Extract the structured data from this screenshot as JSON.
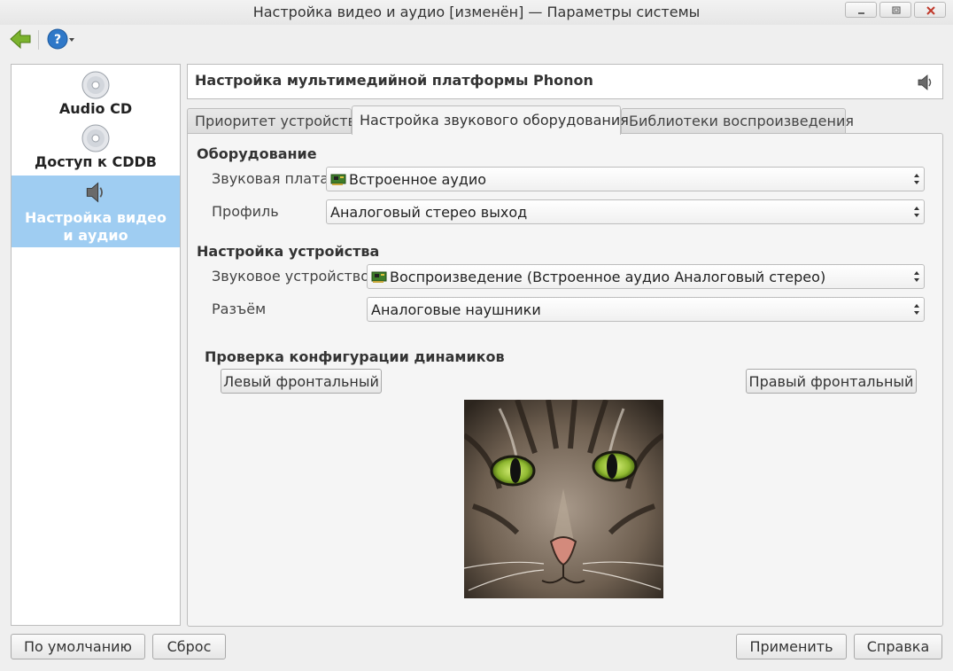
{
  "window": {
    "title": "Настройка видео и аудио [изменён] — Параметры системы"
  },
  "sidebar": {
    "items": [
      {
        "label": "Audio CD",
        "icon": "cd-icon"
      },
      {
        "label": "Доступ к CDDB",
        "icon": "cd-icon"
      },
      {
        "label": "Настройка видео и аудио",
        "icon": "speaker-icon",
        "selected": true
      }
    ]
  },
  "header": {
    "title": "Настройка мультимедийной платформы Phonon"
  },
  "tabs": [
    {
      "label": "Приоритет устройства"
    },
    {
      "label": "Настройка звукового оборудования",
      "active": true
    },
    {
      "label": "Библиотеки воспроизведения"
    }
  ],
  "hardware": {
    "group_title": "Оборудование",
    "sound_card_label": "Звуковая плата",
    "sound_card_value": "Встроенное аудио",
    "profile_label": "Профиль",
    "profile_value": "Аналоговый стерео выход"
  },
  "device": {
    "group_title": "Настройка устройства",
    "sound_device_label": "Звуковое устройство",
    "sound_device_value": "Воспроизведение (Встроенное аудио Аналоговый стерео)",
    "connector_label": "Разъём",
    "connector_value": "Аналоговые наушники"
  },
  "speaker_test": {
    "title": "Проверка конфигурации динамиков",
    "left_front": "Левый фронтальный",
    "right_front": "Правый фронтальный"
  },
  "bottom": {
    "defaults": "По умолчанию",
    "reset": "Сброс",
    "apply": "Применить",
    "help": "Справка"
  },
  "colors": {
    "selection": "#9fcdf2",
    "back_arrow": "#7bb32e",
    "help_blue": "#2f78c8"
  }
}
